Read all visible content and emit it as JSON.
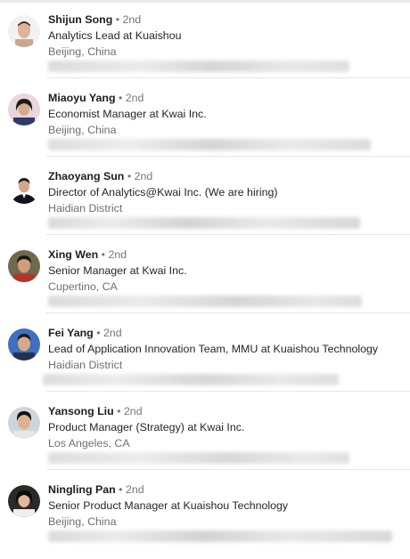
{
  "people": [
    {
      "name": "Shijun Song",
      "degree": "• 2nd",
      "headline": "Analytics Lead at Kuaishou",
      "location": "Beijing, China",
      "avatar_icon": "person-photo-icon"
    },
    {
      "name": "Miaoyu Yang",
      "degree": "• 2nd",
      "headline": "Economist Manager at Kwai Inc.",
      "location": "Beijing, China",
      "avatar_icon": "person-photo-icon"
    },
    {
      "name": "Zhaoyang Sun",
      "degree": "• 2nd",
      "headline": "Director of Analytics@Kwai Inc.  (We are hiring)",
      "location": "Haidian District",
      "avatar_icon": "person-photo-icon"
    },
    {
      "name": "Xing Wen",
      "degree": "• 2nd",
      "headline": "Senior Manager at Kwai Inc.",
      "location": "Cupertino, CA",
      "avatar_icon": "person-photo-icon"
    },
    {
      "name": "Fei Yang",
      "degree": "• 2nd",
      "headline": "Lead of Application Innovation Team, MMU at Kuaishou Technology",
      "location": "Haidian District",
      "avatar_icon": "person-photo-icon"
    },
    {
      "name": "Yansong Liu",
      "degree": "• 2nd",
      "headline": "Product Manager (Strategy) at Kwai Inc.",
      "location": "Los Angeles, CA",
      "avatar_icon": "person-photo-icon"
    },
    {
      "name": "Ningling Pan",
      "degree": "• 2nd",
      "headline": "Senior Product Manager at Kuaishou Technology",
      "location": "Beijing, China",
      "avatar_icon": "person-photo-icon"
    }
  ]
}
